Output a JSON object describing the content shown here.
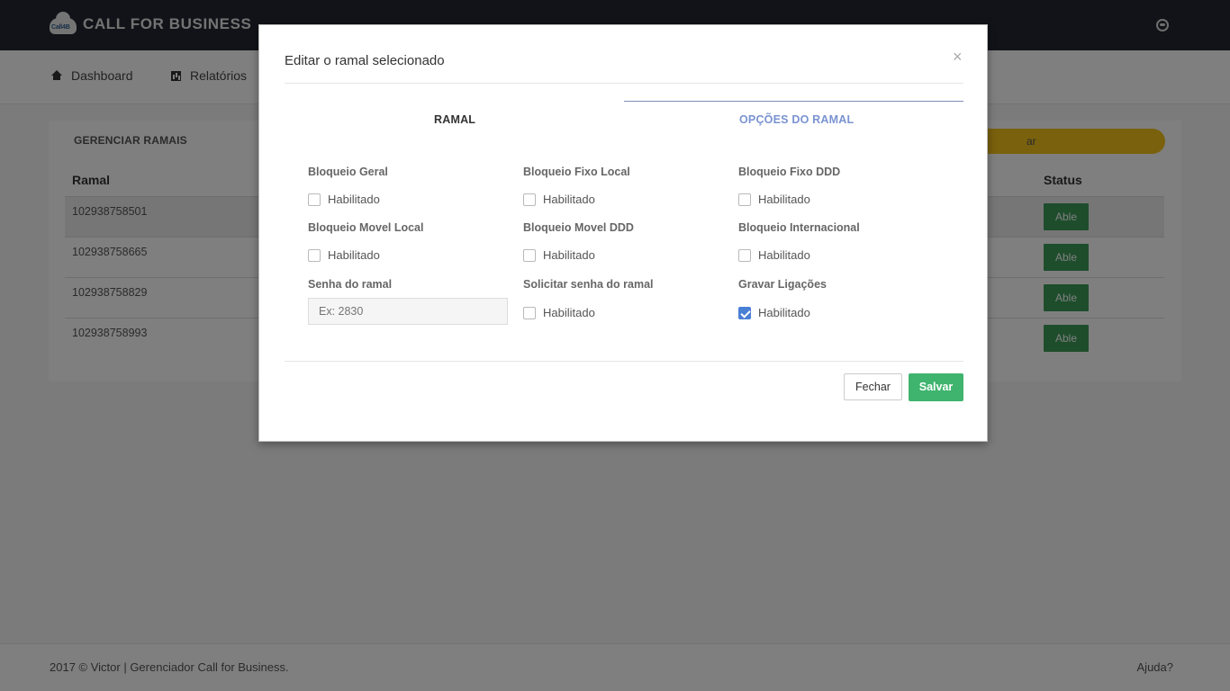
{
  "app": {
    "brand_name": "CALL FOR BUSINESS",
    "logo_text": "Call4B"
  },
  "nav": {
    "items": [
      {
        "label": "Dashboard",
        "icon": "home-icon"
      },
      {
        "label": "Relatórios",
        "icon": "bar-chart-icon"
      }
    ]
  },
  "panel": {
    "title": "GERENCIAR RAMAIS",
    "search_label_partial": "ar",
    "columns": [
      "Ramal",
      "Status"
    ],
    "rows": [
      {
        "ramal": "102938758501",
        "status": "Able"
      },
      {
        "ramal": "102938758665",
        "status": "Able"
      },
      {
        "ramal": "102938758829",
        "status": "Able"
      },
      {
        "ramal": "102938758993",
        "status": "Able"
      }
    ]
  },
  "footer": {
    "copyright": "2017 © Victor | Gerenciador Call for Business.",
    "help": "Ajuda?"
  },
  "modal": {
    "title": "Editar o ramal selecionado",
    "close": "×",
    "tabs": [
      {
        "label": "RAMAL",
        "active": false
      },
      {
        "label": "OPÇÕES DO RAMAL",
        "active": true
      }
    ],
    "options": [
      {
        "label": "Bloqueio Geral",
        "check_label": "Habilitado",
        "checked": false
      },
      {
        "label": "Bloqueio Fixo Local",
        "check_label": "Habilitado",
        "checked": false
      },
      {
        "label": "Bloqueio Fixo DDD",
        "check_label": "Habilitado",
        "checked": false
      },
      {
        "label": "Bloqueio Movel Local",
        "check_label": "Habilitado",
        "checked": false
      },
      {
        "label": "Bloqueio Movel DDD",
        "check_label": "Habilitado",
        "checked": false
      },
      {
        "label": "Bloqueio Internacional",
        "check_label": "Habilitado",
        "checked": false
      },
      {
        "label": "Solicitar senha do ramal",
        "check_label": "Habilitado",
        "checked": false
      },
      {
        "label": "Gravar Ligações",
        "check_label": "Habilitado",
        "checked": true
      }
    ],
    "password": {
      "label": "Senha do ramal",
      "placeholder": "Ex: 2830",
      "value": ""
    },
    "buttons": {
      "close": "Fechar",
      "save": "Salvar"
    }
  },
  "colors": {
    "topbar": "#222731",
    "accent_tab": "#7a93d1",
    "save_button": "#3fb46e",
    "status_button": "#3d9b59",
    "search_pill": "#f3c21b",
    "checkbox_checked": "#4a7fd6"
  }
}
